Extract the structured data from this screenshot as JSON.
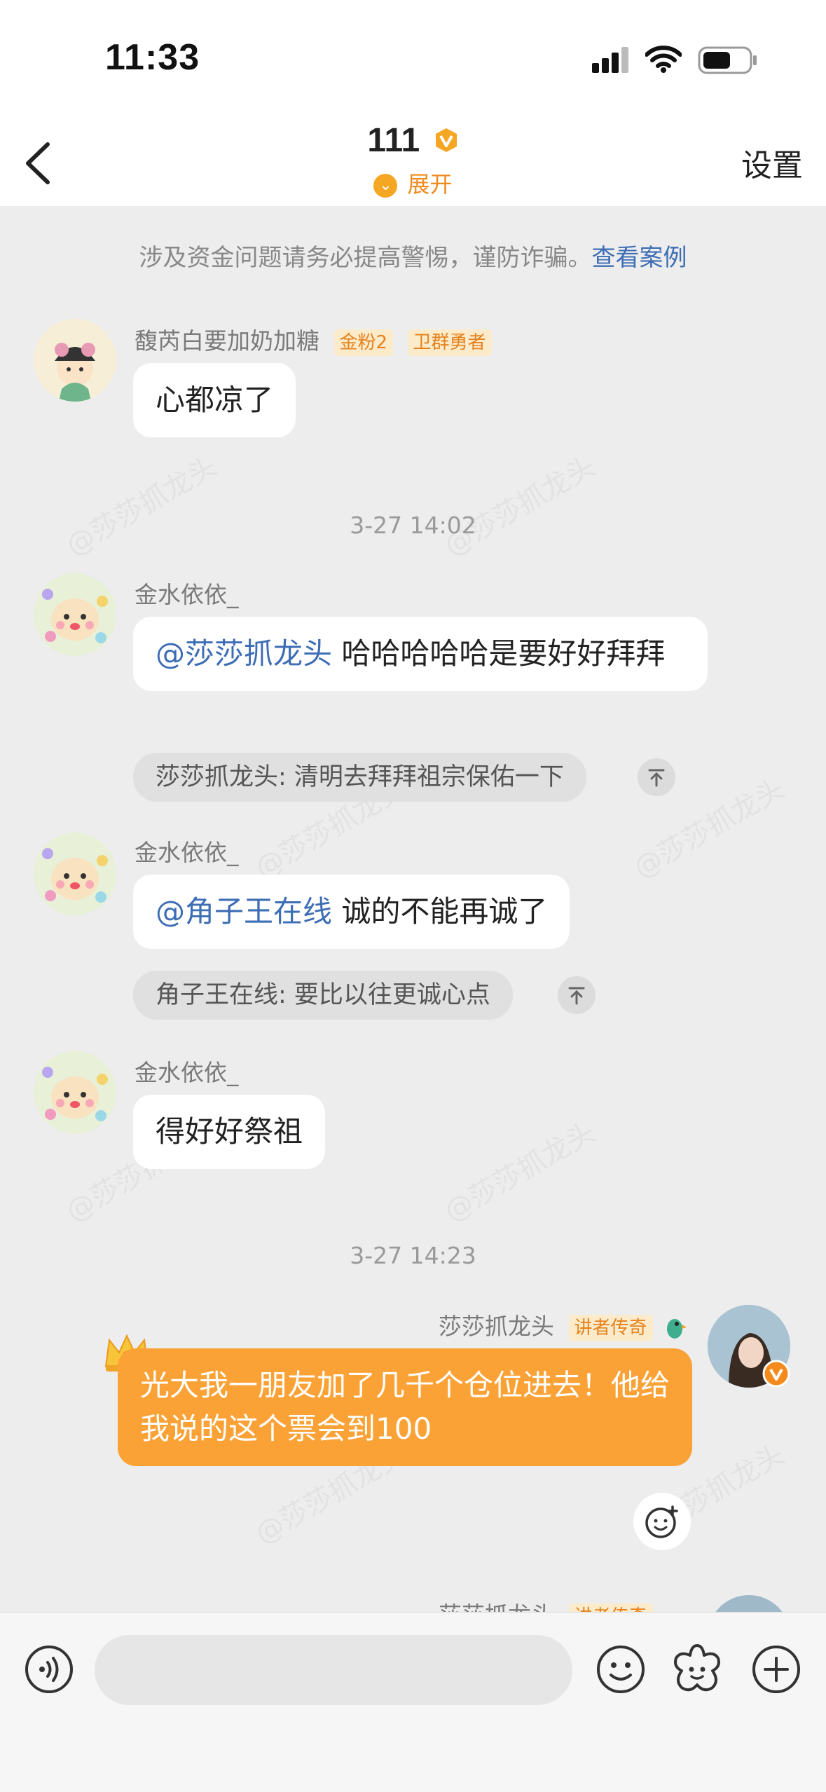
{
  "status": {
    "time": "11:33"
  },
  "header": {
    "title": "111",
    "expand_label": "展开",
    "settings_label": "设置"
  },
  "notice": {
    "text": "涉及资金问题请务必提高警惕，谨防诈骗。",
    "link": "查看案例"
  },
  "messages": [
    {
      "sender": "馥芮白要加奶加糖",
      "badge1": "金粉2",
      "badge2": "卫群勇者",
      "text": "心都凉了"
    },
    {
      "time": "3-27 14:02"
    },
    {
      "sender": "金水依依_",
      "mention": "@莎莎抓龙头",
      "text": "哈哈哈哈哈是要好好拜拜",
      "quote": "莎莎抓龙头: 清明去拜拜祖宗保佑一下"
    },
    {
      "sender": "金水依依_",
      "mention": "@角子王在线",
      "text": "诚的不能再诚了",
      "quote": "角子王在线: 要比以往更诚心点"
    },
    {
      "sender": "金水依依_",
      "text": "得好好祭祖"
    },
    {
      "time": "3-27 14:23"
    },
    {
      "sender": "莎莎抓龙头",
      "badge": "讲者传奇",
      "text": "光大我一朋友加了几千个仓位进去！他给我说的这个票会到100"
    },
    {
      "sender": "莎莎抓龙头",
      "badge": "讲者传奇"
    }
  ],
  "watermark": "@莎莎抓龙头",
  "colors": {
    "accent": "#f5a623",
    "link": "#3d6db5",
    "own_bubble": "#fba237"
  },
  "icons": [
    "back-icon",
    "voice-icon",
    "emoji-icon",
    "sticker-icon",
    "plus-icon",
    "verified-icon",
    "pin-up-icon"
  ]
}
